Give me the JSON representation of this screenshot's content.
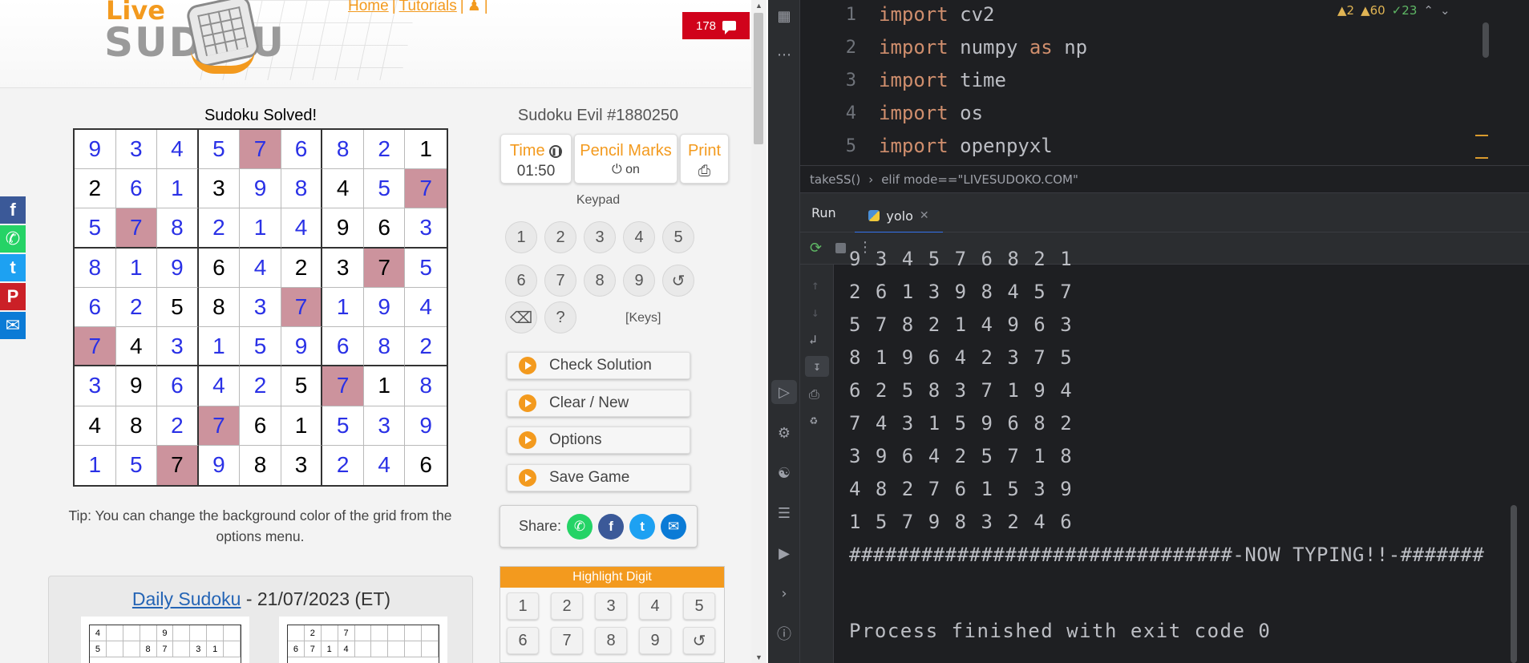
{
  "site": {
    "logo_live": "Live",
    "logo_sudoku": "SUD  KU",
    "nav": {
      "home": "Home",
      "tutorials": "Tutorials",
      "sep": "|"
    },
    "comments_count": "178"
  },
  "social": [
    {
      "name": "facebook",
      "glyph": "f",
      "color": "#3b5998"
    },
    {
      "name": "whatsapp",
      "glyph": "✆",
      "color": "#25d366"
    },
    {
      "name": "twitter",
      "glyph": "t",
      "color": "#1da1f2"
    },
    {
      "name": "pinterest",
      "glyph": "P",
      "color": "#cb2027"
    },
    {
      "name": "email",
      "glyph": "✉",
      "color": "#0b7bd6"
    }
  ],
  "game": {
    "status": "Sudoku Solved!",
    "puzzle_title": "Sudoku Evil #1880250",
    "time_label": "Time",
    "time_value": "01:50",
    "pencil_label": "Pencil Marks",
    "pencil_value": "on",
    "print_label": "Print",
    "keypad_label": "Keypad",
    "keypad": [
      "1",
      "2",
      "3",
      "4",
      "5",
      "6",
      "7",
      "8",
      "9"
    ],
    "undo_glyph": "↺",
    "erase_glyph": "⌫",
    "help_glyph": "?",
    "keys_link": "[Keys]",
    "actions": [
      "Check Solution",
      "Clear / New",
      "Options",
      "Save Game"
    ],
    "share_label": "Share:",
    "highlight_title": "Highlight Digit",
    "highlight_digits": [
      "1",
      "2",
      "3",
      "4",
      "5",
      "6",
      "7",
      "8",
      "9"
    ],
    "tip": "Tip: You can change the background color of the grid from the options menu.",
    "grid": [
      [
        9,
        3,
        4,
        5,
        7,
        6,
        8,
        2,
        1
      ],
      [
        2,
        6,
        1,
        3,
        9,
        8,
        4,
        5,
        7
      ],
      [
        5,
        7,
        8,
        2,
        1,
        4,
        9,
        6,
        3
      ],
      [
        8,
        1,
        9,
        6,
        4,
        2,
        3,
        7,
        5
      ],
      [
        6,
        2,
        5,
        8,
        3,
        7,
        1,
        9,
        4
      ],
      [
        7,
        4,
        3,
        1,
        5,
        9,
        6,
        8,
        2
      ],
      [
        3,
        9,
        6,
        4,
        2,
        5,
        7,
        1,
        8
      ],
      [
        4,
        8,
        2,
        7,
        6,
        1,
        5,
        3,
        9
      ],
      [
        1,
        5,
        7,
        9,
        8,
        3,
        2,
        4,
        6
      ]
    ],
    "given": [
      [
        0,
        0,
        0,
        0,
        0,
        0,
        0,
        0,
        1
      ],
      [
        1,
        0,
        0,
        1,
        0,
        0,
        1,
        0,
        0
      ],
      [
        0,
        0,
        0,
        0,
        0,
        0,
        1,
        1,
        0
      ],
      [
        0,
        0,
        0,
        1,
        0,
        1,
        1,
        1,
        0
      ],
      [
        0,
        0,
        1,
        1,
        0,
        0,
        0,
        0,
        0
      ],
      [
        0,
        1,
        0,
        0,
        0,
        0,
        0,
        0,
        0
      ],
      [
        0,
        1,
        0,
        0,
        0,
        1,
        0,
        1,
        0
      ],
      [
        1,
        1,
        0,
        0,
        1,
        1,
        0,
        0,
        0
      ],
      [
        0,
        0,
        1,
        0,
        1,
        1,
        0,
        0,
        1
      ]
    ],
    "highlighted_digit": 7
  },
  "daily": {
    "link": "Daily Sudoku",
    "date": " - 21/07/2023 (ET)",
    "mini1": [
      "4",
      "",
      "",
      "",
      "9",
      "",
      "",
      "",
      "",
      "5",
      "",
      "",
      "8",
      "7",
      "",
      "3",
      "1",
      ""
    ],
    "mini2": [
      "",
      "2",
      "",
      "7",
      "",
      "",
      "",
      "",
      "",
      "6",
      "7",
      "1",
      "4",
      "",
      "",
      "",
      "",
      ""
    ]
  },
  "ide": {
    "code": [
      {
        "n": "1",
        "kw": "import",
        "rest": " cv2"
      },
      {
        "n": "2",
        "kw": "import",
        "rest": " numpy ",
        "kw2": "as",
        "rest2": " np"
      },
      {
        "n": "3",
        "kw": "import",
        "rest": " time"
      },
      {
        "n": "4",
        "kw": "import",
        "rest": " os"
      },
      {
        "n": "5",
        "kw": "import",
        "rest": " openpyxl"
      }
    ],
    "inspections": {
      "warn1": "▲2",
      "warn2": "▲60",
      "ok": "✓23"
    },
    "breadcrumb": [
      "takeSS()",
      "›",
      "elif mode==\"LIVESUDOKO.COM\""
    ],
    "run_title": "Run",
    "run_tab": "yolo",
    "console_lines": [
      "9 3 4 5 7 6 8 2 1",
      "2 6 1 3 9 8 4 5 7",
      "5 7 8 2 1 4 9 6 3",
      "8 1 9 6 4 2 3 7 5",
      "6 2 5 8 3 7 1 9 4",
      "7 4 3 1 5 9 6 8 2",
      "3 9 6 4 2 5 7 1 8",
      "4 8 2 7 6 1 5 3 9",
      "1 5 7 9 8 3 2 4 6",
      "################################-NOW TYPING!!-#######"
    ],
    "exit_line": "Process finished with exit code 0"
  }
}
